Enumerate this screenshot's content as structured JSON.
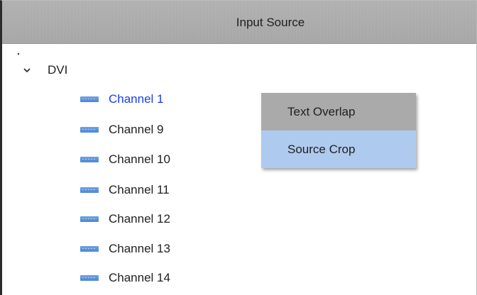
{
  "panel": {
    "title": "Input Source"
  },
  "tree": {
    "root": {
      "label": "DVI",
      "expanded": true,
      "icon": "chevron-down-icon"
    },
    "channels": [
      {
        "label": "Channel 1",
        "selected": true
      },
      {
        "label": "Channel 9",
        "selected": false
      },
      {
        "label": "Channel 10",
        "selected": false
      },
      {
        "label": "Channel 11",
        "selected": false
      },
      {
        "label": "Channel 12",
        "selected": false
      },
      {
        "label": "Channel 13",
        "selected": false
      },
      {
        "label": "Channel 14",
        "selected": false
      }
    ],
    "channel_icon": "input-port-icon"
  },
  "context_menu": {
    "items": [
      {
        "label": "Text Overlap"
      },
      {
        "label": "Source Crop"
      }
    ]
  },
  "colors": {
    "header_bg": "#aaaaaa",
    "selected_text": "#1a3cf0",
    "menu_highlight": "#aecbef",
    "menu_item_bg": "#aaaaaa",
    "channel_icon": "#5b8fd8"
  }
}
